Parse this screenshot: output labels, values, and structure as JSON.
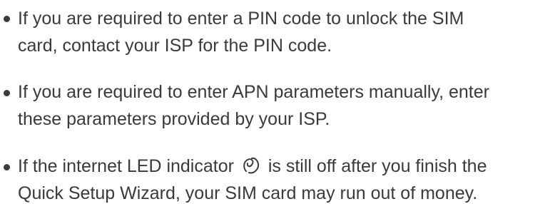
{
  "notes": {
    "items": [
      {
        "line1": "If you are required to enter a PIN code to unlock the SIM",
        "line2": "card, contact your ISP for the PIN code."
      },
      {
        "line1": "If you are required to enter APN parameters manually, enter",
        "line2": "these parameters provided by your ISP."
      },
      {
        "line1_before_icon": "If the internet LED indicator",
        "icon": "internet-led-icon",
        "line1_after_icon": "is still off after you finish the",
        "line2": "Quick Setup Wizard, your SIM card may run out of money."
      }
    ]
  }
}
